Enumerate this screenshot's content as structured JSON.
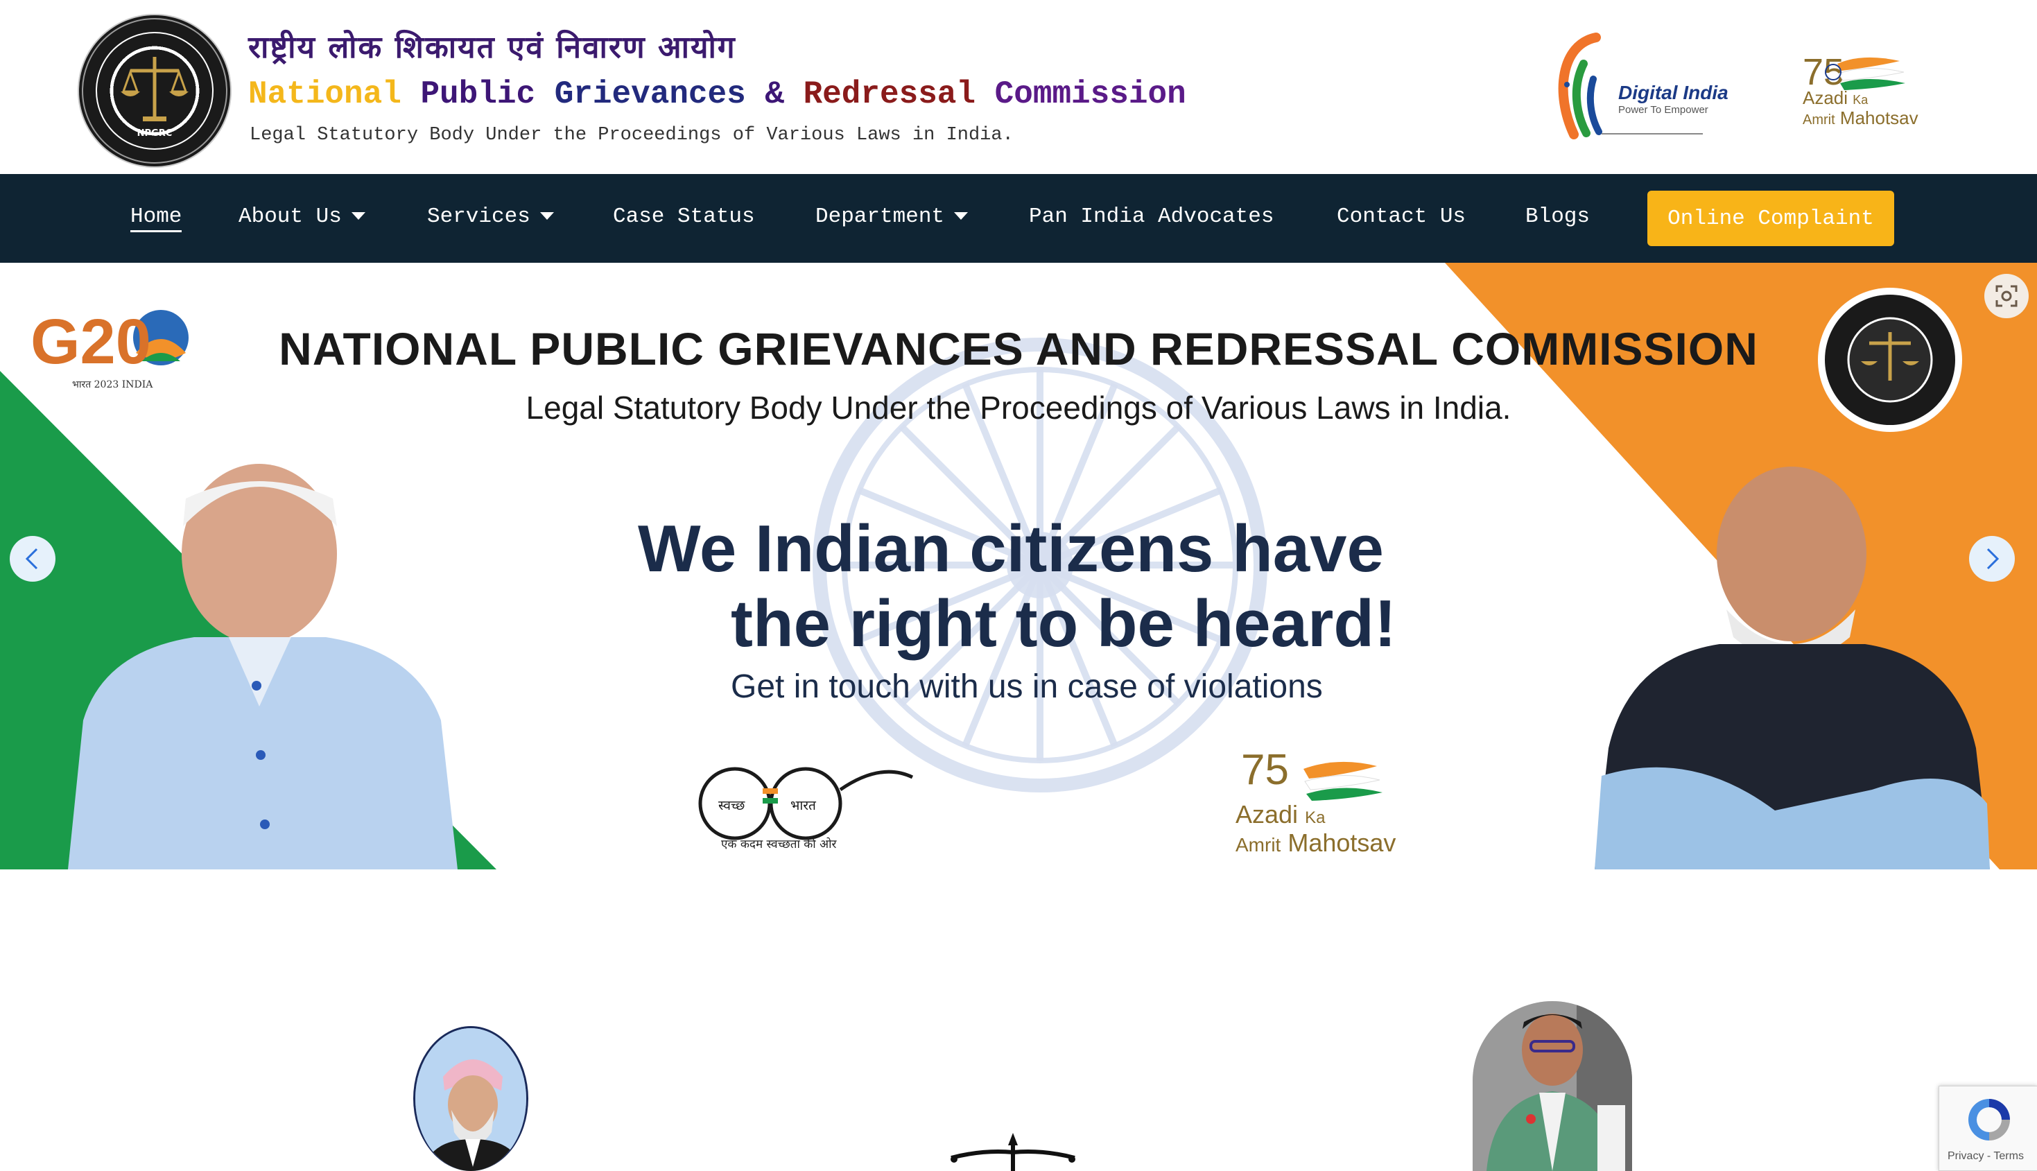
{
  "header": {
    "title_hindi": "राष्ट्रीय लोक शिकायत एवं निवारण आयोग",
    "title_words": [
      "National",
      "Public",
      "Grievances",
      "&",
      "Redressal",
      "Commission"
    ],
    "tagline": "Legal Statutory Body Under the Proceedings of Various Laws in India.",
    "emblem_text": "NPGRC",
    "digital_india": {
      "name": "Digital India",
      "slogan": "Power To Empower"
    },
    "azadi": {
      "line1": "Azadi",
      "ka": "Ka",
      "line2": "Amrit",
      "line3": "Mahotsav",
      "number": "75"
    }
  },
  "nav": {
    "items": [
      {
        "label": "Home",
        "active": true,
        "dropdown": false
      },
      {
        "label": "About Us",
        "dropdown": true
      },
      {
        "label": "Services",
        "dropdown": true
      },
      {
        "label": "Case Status",
        "dropdown": false
      },
      {
        "label": "Department",
        "dropdown": true
      },
      {
        "label": "Pan India Advocates",
        "dropdown": false
      },
      {
        "label": "Contact Us",
        "dropdown": false
      },
      {
        "label": "Blogs",
        "dropdown": false
      }
    ],
    "cta_label": "Online Complaint"
  },
  "banner": {
    "title": "NATIONAL PUBLIC GRIEVANCES AND REDRESSAL COMMISSION",
    "subtitle": "Legal Statutory Body Under the Proceedings of Various Laws in India.",
    "headline_line1": "We Indian citizens have",
    "headline_line2": "the right to be heard!",
    "cta_text": "Get in touch with us in case of violations",
    "g20": "G20",
    "g20_sub": "भारत 2023 INDIA",
    "swachh_left": "स्वच्छ",
    "swachh_right": "भारत",
    "swachh_caption": "एक कदम स्वच्छता की ओर",
    "azadi": {
      "line1": "Azadi",
      "ka": "Ka",
      "line2": "Amrit",
      "line3": "Mahotsav",
      "number": "75"
    }
  },
  "recaptcha": {
    "links": "Privacy - Terms"
  },
  "colors": {
    "nav_bg": "#0f2433",
    "cta_bg": "#f8b418",
    "saffron": "#f2912a",
    "green": "#1a9b4a",
    "navy_text": "#1b2c4a"
  }
}
